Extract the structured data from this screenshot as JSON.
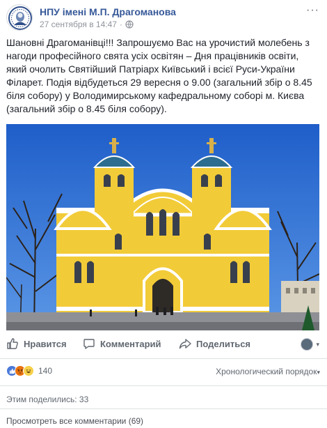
{
  "post": {
    "page_name": "НПУ імені М.П. Драгоманова",
    "timestamp": "27 сентября в 14:47",
    "separator": "·",
    "privacy_icon": "globe-icon",
    "more_label": "···",
    "text": "Шановні Драгоманівці!!! Запрошуємо Вас на урочистий молебень з нагоди професійного свята усіх освітян – Дня працівників освіти, який очолить Святійший Патріарх Київський і всієї Руси-України Філарет. Подія відбудеться 29 вересня о 9.00 (загальний збір о 8.45 біля собору) у Володимирському кафедральному соборі м. Києва (загальний збір о 8.45 біля собору)."
  },
  "actions": {
    "like": "Нравится",
    "comment": "Комментарий",
    "share": "Поделиться"
  },
  "reactions": {
    "count": "140",
    "types": [
      "like",
      "angry",
      "haha"
    ],
    "order_label": "Хронологический порядок",
    "order_caret": "▾"
  },
  "shares": "Этим поделились: 33",
  "view_comments": "Просмотреть все комментарии (69)",
  "colors": {
    "link": "#365899",
    "meta": "#90949c",
    "cathedral": "#f3cf3a",
    "sky": "#2a6fd6"
  }
}
